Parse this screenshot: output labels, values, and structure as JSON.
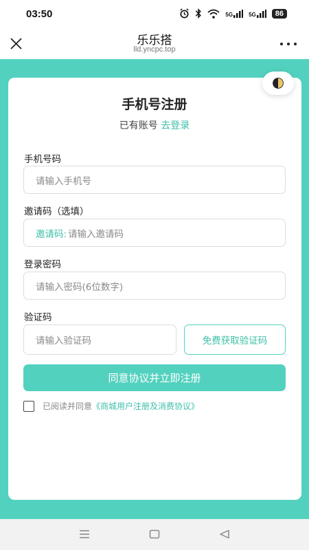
{
  "status": {
    "time": "03:50",
    "signal1": "5G",
    "signal2": "5G",
    "battery": "86"
  },
  "header": {
    "title": "乐乐搭",
    "url": "lld.yncpc.top"
  },
  "form": {
    "title": "手机号注册",
    "has_account": "已有账号",
    "login_link": "去登录",
    "phone": {
      "label": "手机号码",
      "placeholder": "请输入手机号"
    },
    "invite": {
      "label": "邀请码（选填）",
      "prefix": "邀请码:",
      "placeholder": "请输入邀请码"
    },
    "password": {
      "label": "登录密码",
      "placeholder": "请输入密码(6位数字)"
    },
    "code": {
      "label": "验证码",
      "placeholder": "请输入验证码",
      "button": "免费获取验证码"
    },
    "submit": "同意协议并立即注册",
    "agreement": {
      "text": "已阅读并同意",
      "link": "《商城用户注册及消费协议》",
      "checked": false
    }
  },
  "colors": {
    "accent": "#53d1bf",
    "accent_text": "#3dbfa9"
  },
  "icons": {
    "close": "close-icon",
    "more": "more-icon",
    "theme": "theme-toggle-icon",
    "nav_menu": "menu-icon",
    "nav_home": "home-icon",
    "nav_back": "back-icon"
  }
}
